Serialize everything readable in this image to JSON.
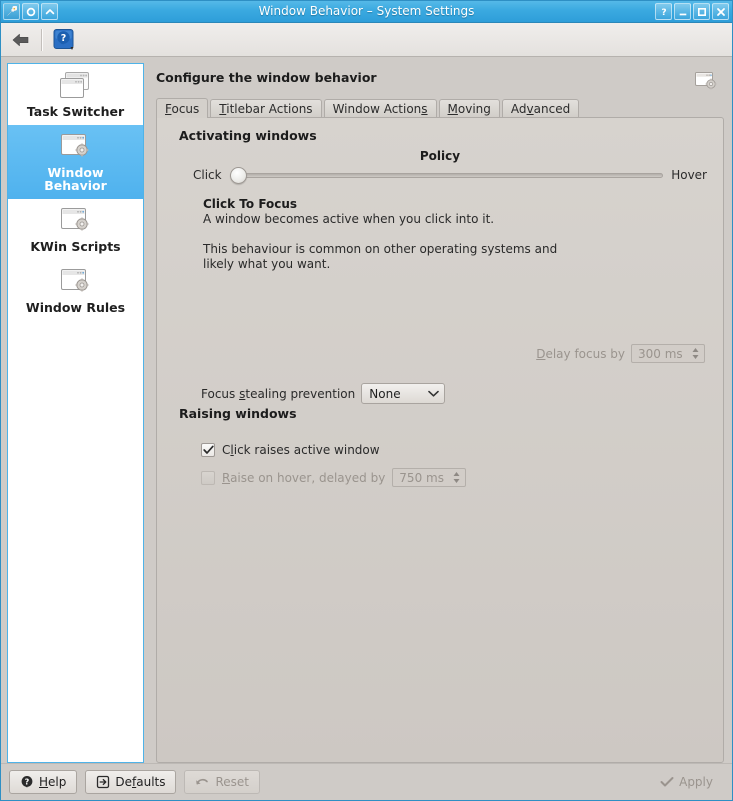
{
  "window": {
    "title": "Window Behavior – System Settings",
    "titlebar_color": "#3daee9",
    "left_buttons": [
      {
        "name": "app-menu-icon",
        "label": ""
      },
      {
        "name": "keep-above-icon",
        "label": ""
      },
      {
        "name": "shade-icon",
        "label": ""
      }
    ],
    "right_buttons": [
      {
        "name": "help-button",
        "label": "?"
      },
      {
        "name": "minimize-button",
        "label": "_"
      },
      {
        "name": "maximize-button",
        "label": "□"
      },
      {
        "name": "close-button",
        "label": "✕"
      }
    ]
  },
  "toolbar": {
    "back_icon": "back-arrow-icon",
    "help_icon": "help-question-icon"
  },
  "sidebar": {
    "items": [
      {
        "label": "Task Switcher",
        "icon": "task-switcher-icon",
        "selected": false
      },
      {
        "label_line1": "Window",
        "label_line2": "Behavior",
        "label": "Window Behavior",
        "icon": "window-behavior-icon",
        "selected": true
      },
      {
        "label": "KWin Scripts",
        "icon": "kwin-scripts-icon",
        "selected": false
      },
      {
        "label": "Window Rules",
        "icon": "window-rules-icon",
        "selected": false
      }
    ]
  },
  "content": {
    "header_title": "Configure the window behavior",
    "module_icon": "window-gear-icon",
    "tabs": [
      {
        "label": "Focus",
        "accel": "F",
        "active": true
      },
      {
        "label": "Titlebar Actions",
        "accel": "T",
        "active": false
      },
      {
        "label": "Window Actions",
        "accel": "s",
        "active": false
      },
      {
        "label": "Moving",
        "accel": "M",
        "active": false
      },
      {
        "label": "Advanced",
        "accel": "v",
        "active": false
      }
    ],
    "activating": {
      "group_title": "Activating windows",
      "policy_label": "Policy",
      "slider_min_label": "Click",
      "slider_max_label": "Hover",
      "slider_value": 0,
      "slider_min": 0,
      "slider_max": 4,
      "description_heading": "Click To Focus",
      "description_line1": "A window becomes active when you click into it.",
      "description_line2": "This behaviour is common on other operating systems and likely what you want."
    },
    "delay_focus": {
      "label_pre": "D",
      "label_rest": "elay focus by",
      "label": "Delay focus by",
      "value": "300 ms",
      "enabled": false
    },
    "focus_stealing": {
      "label_pre": "Focus ",
      "label_accel": "s",
      "label_post": "tealing prevention",
      "label": "Focus stealing prevention",
      "value": "None"
    },
    "raising": {
      "group_title": "Raising windows",
      "click_raises": {
        "label_pre": "C",
        "label_accel": "l",
        "label_post": "ick raises active window",
        "label": "Click raises active window",
        "checked": true,
        "enabled": true
      },
      "raise_on_hover": {
        "label_pre": "",
        "label_accel": "R",
        "label_post": "aise on hover, delayed by",
        "label": "Raise on hover, delayed by",
        "checked": false,
        "enabled": false,
        "value": "750 ms"
      }
    }
  },
  "bottombar": {
    "help": {
      "label_accel": "H",
      "label_post": "elp",
      "label": "Help",
      "icon": "help-icon",
      "enabled": true
    },
    "defaults": {
      "label_pre": "De",
      "label_accel": "f",
      "label_post": "aults",
      "label": "Defaults",
      "icon": "defaults-icon",
      "enabled": true
    },
    "reset": {
      "label": "Reset",
      "icon": "undo-icon",
      "enabled": false
    },
    "apply": {
      "label": "Apply",
      "icon": "check-icon",
      "enabled": false
    }
  }
}
